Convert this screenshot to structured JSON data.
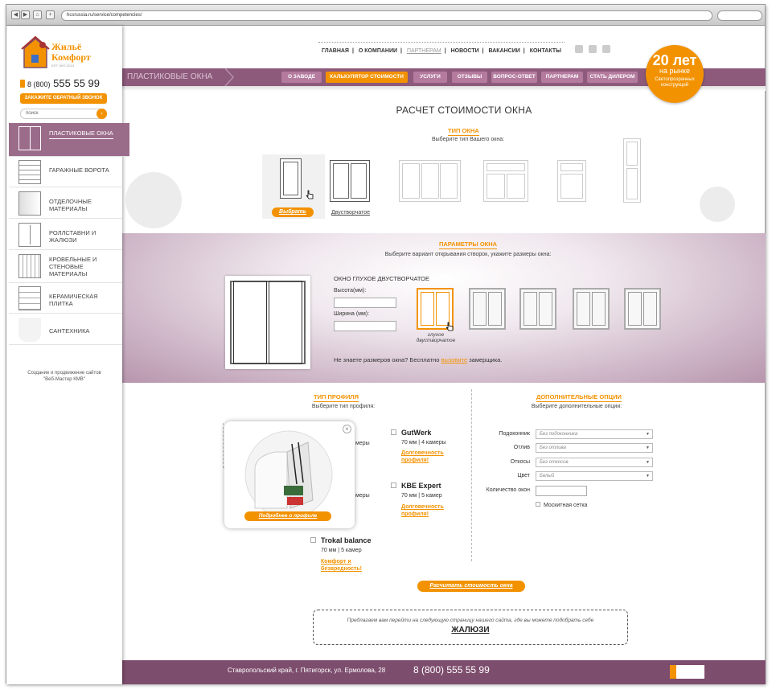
{
  "browser": {
    "url": "hcsrussia.ru/service/competencies/"
  },
  "brand": {
    "name_line1": "Жильё",
    "name_line2": "Комфорт",
    "tagline": "EST 1997-2013"
  },
  "sidebar": {
    "phone_prefix": "8 (800)",
    "phone_number": "555 55 99",
    "callback_label": "ЗАКАЖИТЕ ОБРАТНЫЙ ЗВОНОК",
    "search_placeholder": "поиск",
    "categories": [
      {
        "label": "ПЛАСТИКОВЫЕ ОКНА",
        "active": true
      },
      {
        "label": "ГАРАЖНЫЕ ВОРОТА"
      },
      {
        "label": "ОТДЕЛОЧНЫЕ МАТЕРИАЛЫ"
      },
      {
        "label": "РОЛЛСТАВНИ И ЖАЛЮЗИ"
      },
      {
        "label": "КРОВЕЛЬНЫЕ И СТЕНОВЫЕ МАТЕРИАЛЫ"
      },
      {
        "label": "КЕРАМИЧЕСКАЯ ПЛИТКА"
      },
      {
        "label": "САНТЕХНИКА"
      }
    ],
    "credit_line1": "Создание и продвижение сайтов",
    "credit_line2": "\"Веб-Мастер КМВ\""
  },
  "topnav": [
    "ГЛАВНАЯ",
    "О КОМПАНИИ",
    "ПАРТНЕРАМ",
    "НОВОСТИ",
    "ВАКАНСИИ",
    "КОНТАКТЫ"
  ],
  "section_title": "ПЛАСТИКОВЫЕ ОКНА",
  "subnav": [
    "О ЗАВОДЕ",
    "КАЛЬКУЛЯТОР СТОИМОСТИ",
    "УСЛУГИ",
    "ОТЗЫВЫ",
    "ВОПРОС-ОТВЕТ",
    "ПАРТНЕРАМ",
    "СТАТЬ ДИЛЕРОМ"
  ],
  "badge": {
    "number": "20 лет",
    "line2": "на рынке",
    "line3": "Светопрозрачных конструкций"
  },
  "page_title": "РАСЧЕТ СТОИМОСТИ ОКНА",
  "window_type": {
    "heading": "ТИП ОКНА",
    "hint": "Выберите тип Вашего окна:",
    "select_label": "Выбрать",
    "selected_caption": "Двустворчатое"
  },
  "params": {
    "heading": "ПАРАМЕТРЫ ОКНА",
    "hint": "Выберите вариант открывания створок, укажите размеры окна:",
    "window_name": "ОКНО ГЛУХОЕ ДВУСТВОРЧАТОЕ",
    "height_label": "Высота(мм):",
    "width_label": "Ширина (мм):",
    "opening_caption": "глухое двустворчатое",
    "note_prefix": "Не знаете размеров окна?  Бесплатно ",
    "note_link": "вызовите",
    "note_suffix": " замерщика."
  },
  "profile": {
    "heading": "ТИП ПРОФИЛЯ",
    "hint": "Выберите тип профиля:",
    "items": [
      {
        "name": "GutWerk",
        "spec": "70 мм | 4 камеры",
        "link1": "Долговечность",
        "link2": "профиля!"
      },
      {
        "name": "KBE Expert",
        "spec": "70 мм | 5 камер",
        "link1": "Долговечность",
        "link2": "профиля!"
      },
      {
        "name": "Trokal balance",
        "spec": "70 мм | 5 камер",
        "link1": "Комфорт и",
        "link2": "безвредность!"
      }
    ],
    "partial_spec1": "меры",
    "partial_spec2": "меры",
    "popup_link": "Подробнее о профиле"
  },
  "options": {
    "heading": "ДОПОЛНИТЕЛЬНЫЕ ОПЦИИ",
    "hint": "Выберите дополнительные опции:",
    "rows": [
      {
        "label": "Подоконник",
        "value": "Без подоконника"
      },
      {
        "label": "Отлив",
        "value": "Без отлива"
      },
      {
        "label": "Откосы",
        "value": "Без откосов"
      },
      {
        "label": "Цвет",
        "value": "Белый"
      }
    ],
    "qty_label": "Количество окон",
    "net_label": "Москитная сетка"
  },
  "calc_button": "Расчитать стоимость окна",
  "offer": {
    "text": "Предлагаем вам перейти на следующую страницу нашего сайта, где вы можете подобрать себе",
    "link": "ЖАЛЮЗИ"
  },
  "footer": {
    "address": "Ставропольский край, г. Пятигорск, ул. Ермолова, 28",
    "phone": "8 (800) 555 55 99"
  },
  "colors": {
    "accent": "#f39200",
    "plum": "#8d5a7b"
  }
}
